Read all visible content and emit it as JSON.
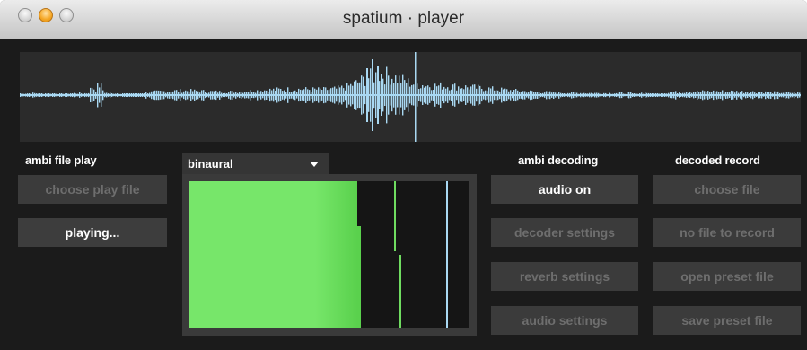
{
  "window": {
    "title": "spatium · player"
  },
  "ambi_file_play": {
    "label": "ambi file  play",
    "choose_button": "choose play file",
    "playing_button": "playing..."
  },
  "decoder_mode": {
    "selected": "binaural"
  },
  "ambi_decoding": {
    "label": "ambi decoding",
    "audio_on": "audio on",
    "decoder_settings": "decoder settings",
    "reverb_settings": "reverb settings",
    "audio_settings": "audio settings"
  },
  "decoded_record": {
    "label": "decoded record",
    "choose_file": "choose file",
    "no_file": "no file to record",
    "open_preset": "open preset file",
    "save_preset": "save preset file"
  },
  "colors": {
    "waveform": "#a9d8f2",
    "meter_green": "#77e66a",
    "meter_blue": "#a9d8f2",
    "button_disabled_text": "#6e6e6e"
  }
}
